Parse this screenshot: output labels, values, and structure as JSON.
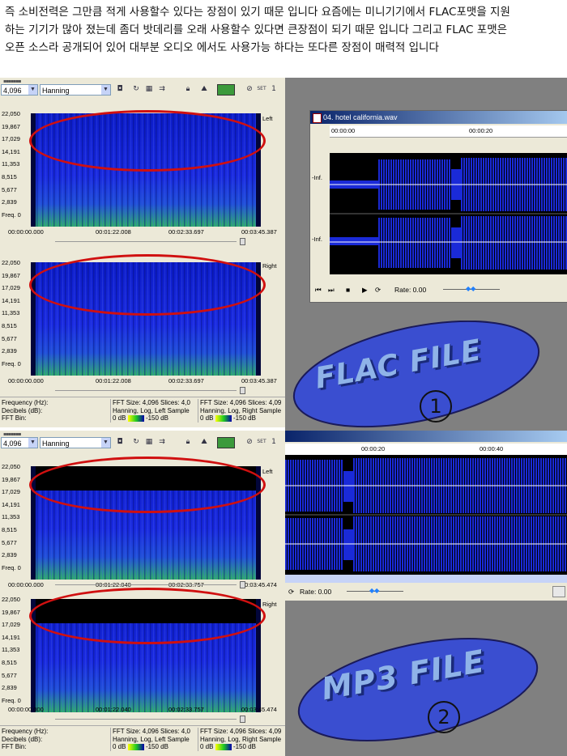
{
  "caption": {
    "line1": "즉 소비전력은 그만큼 적게 사용할수 있다는 장점이 있기 때문 입니다 요즘에는 미니기기에서 FLAC포맷을 지원",
    "line2": "하는 기기가 많아 졌는데 좀더 밧데리를 오래 사용할수 있다면 큰장점이 되기 때문 입니다 그리고 FLAC 포맷은",
    "line3": "오픈 소스라 공개되어 있어 대부분 오디오 에서도 사용가능 하다는 또다른 장점이 매력적 입니다"
  },
  "analyzers": [
    {
      "id": "flac",
      "fft_value": "4,096",
      "window_value": "Hanning",
      "set_label": "SET",
      "set_num": "1",
      "y_ticks": [
        "22,050",
        "19,867",
        "17,029",
        "14,191",
        "11,353",
        "8,515",
        "5,677",
        "2,839",
        "Freq. 0"
      ],
      "left_label": "Left",
      "right_label": "Right",
      "x_ticks": [
        "00:00:00.000",
        "00:01:22.008",
        "00:02:33.697",
        "00:03:45.387"
      ],
      "status": {
        "labels": [
          "Frequency (Hz):",
          "Decibels (dB):",
          "FFT Bin:"
        ],
        "left_box": [
          "FFT Size: 4,096  Slices: 4,0",
          "Hanning, Log, Left  Sample",
          "0 dB",
          "-150 dB"
        ],
        "right_box": [
          "FFT Size: 4,096  Slices: 4,09",
          "Hanning, Log, Right  Sample",
          "0 dB",
          "-150 dB"
        ]
      }
    },
    {
      "id": "mp3",
      "fft_value": "4,096",
      "window_value": "Hanning",
      "set_label": "SET",
      "set_num": "1",
      "y_ticks": [
        "22,050",
        "19,867",
        "17,029",
        "14,191",
        "11,353",
        "8,515",
        "5,677",
        "2,839",
        "Freq. 0"
      ],
      "left_label": "Left",
      "right_label": "Right",
      "x_ticks": [
        "00:00:00.000",
        "00:01:22.040",
        "00:02:33.757",
        "00:03:45.474"
      ],
      "status": {
        "labels": [
          "Frequency (Hz):",
          "Decibels (dB):",
          "FFT Bin:"
        ],
        "left_box": [
          "FFT Size: 4,096  Slices: 4,0",
          "Hanning, Log, Left  Sample",
          "0 dB",
          "-150 dB"
        ],
        "right_box": [
          "FFT Size: 4,096  Slices: 4,09",
          "Hanning, Log, Right  Sample",
          "0 dB",
          "-150 dB"
        ]
      }
    }
  ],
  "wave_window": {
    "title": "04. hotel california.wav",
    "ruler": [
      "00:00:00",
      "00:00:20"
    ],
    "channel_labels": [
      "-Inf.",
      "-Inf."
    ],
    "rate": "Rate: 0.00"
  },
  "wave2": {
    "ruler": [
      "00:00:20",
      "00:00:40"
    ],
    "rate": "Rate: 0.00"
  },
  "labels": {
    "flac": "FLAC FILE",
    "flac_num": "1",
    "mp3": "MP3 FILE",
    "mp3_num": "2"
  },
  "colors": {
    "panel_bg": "#ece9d8",
    "spectrogram_blue": "#1a2ad8",
    "highlight_ring": "#d01010",
    "oval_fill": "#3a4ed0",
    "label_text": "#8fb3e8"
  }
}
